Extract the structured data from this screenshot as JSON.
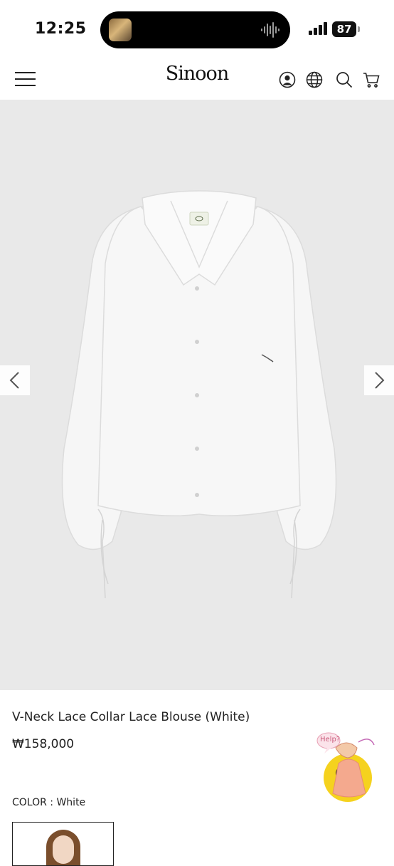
{
  "status_bar": {
    "time": "12:25",
    "battery": "87"
  },
  "header": {
    "brand": "Sinoon"
  },
  "product": {
    "title": "V-Neck Lace Collar Lace Blouse (White)",
    "price": "₩158,000",
    "color_label": "COLOR : White",
    "selected_color": "White"
  },
  "help_widget": {
    "label": "Help?"
  },
  "colors": {
    "hero_background": "#e9e9e9",
    "text": "#222222"
  },
  "icons": [
    "menu-icon",
    "user-icon",
    "globe-icon",
    "search-icon",
    "cart-icon",
    "chevron-left-icon",
    "chevron-right-icon"
  ]
}
